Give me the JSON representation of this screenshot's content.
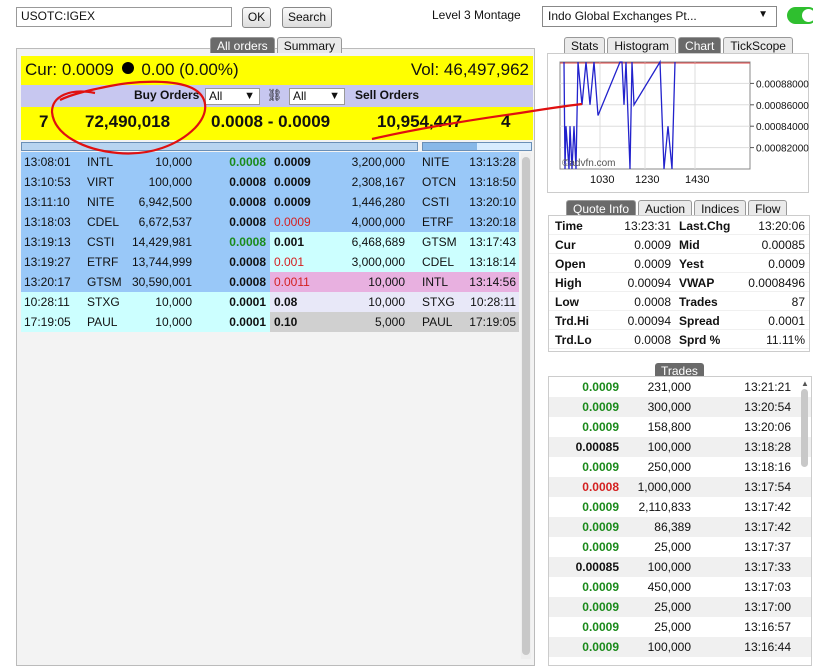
{
  "topbar": {
    "symbol": "USOTC:IGEX",
    "ok_label": "OK",
    "search_label": "Search",
    "montage_label": "Level 3 Montage",
    "exchange_selected": "Indo Global Exchanges Pt..."
  },
  "order_tabs": [
    "All orders",
    "Summary"
  ],
  "header": {
    "cur_label": "Cur:",
    "cur_price": "0.0009",
    "change": "0.00 (0.00%)",
    "vol_label": "Vol:",
    "volume": "46,497,962",
    "buy_orders_label": "Buy Orders",
    "sell_orders_label": "Sell Orders",
    "filter_buy": "All",
    "filter_sell": "All"
  },
  "summary": {
    "buy_count": "7",
    "buy_volume": "72,490,018",
    "spread_range": "0.0008 - 0.0009",
    "sell_volume": "10,954,447",
    "sell_count": "4"
  },
  "book": [
    {
      "bt": "13:08:01",
      "bmm": "INTL",
      "bsize": "10,000",
      "bprice": "0.0008",
      "bcolor": "green",
      "bbg": "#99c8f8",
      "sprice": "0.0009",
      "scolor": "black",
      "ssize": "3,200,000",
      "smm": "NITE",
      "st": "13:13:28",
      "sbg": "#99c8f8"
    },
    {
      "bt": "13:10:53",
      "bmm": "VIRT",
      "bsize": "100,000",
      "bprice": "0.0008",
      "bcolor": "black",
      "bbg": "#99c8f8",
      "sprice": "0.0009",
      "scolor": "black",
      "ssize": "2,308,167",
      "smm": "OTCN",
      "st": "13:18:50",
      "sbg": "#99c8f8"
    },
    {
      "bt": "13:11:10",
      "bmm": "NITE",
      "bsize": "6,942,500",
      "bprice": "0.0008",
      "bcolor": "black",
      "bbg": "#99c8f8",
      "sprice": "0.0009",
      "scolor": "black",
      "ssize": "1,446,280",
      "smm": "CSTI",
      "st": "13:20:10",
      "sbg": "#99c8f8"
    },
    {
      "bt": "13:18:03",
      "bmm": "CDEL",
      "bsize": "6,672,537",
      "bprice": "0.0008",
      "bcolor": "black",
      "bbg": "#99c8f8",
      "sprice": "0.0009",
      "scolor": "red",
      "ssize": "4,000,000",
      "smm": "ETRF",
      "st": "13:20:18",
      "sbg": "#99c8f8"
    },
    {
      "bt": "13:19:13",
      "bmm": "CSTI",
      "bsize": "14,429,981",
      "bprice": "0.0008",
      "bcolor": "green",
      "bbg": "#99c8f8",
      "sprice": "0.001",
      "scolor": "black",
      "ssize": "6,468,689",
      "smm": "GTSM",
      "st": "13:17:43",
      "sbg": "#ccffff"
    },
    {
      "bt": "13:19:27",
      "bmm": "ETRF",
      "bsize": "13,744,999",
      "bprice": "0.0008",
      "bcolor": "black",
      "bbg": "#99c8f8",
      "sprice": "0.001",
      "scolor": "red",
      "ssize": "3,000,000",
      "smm": "CDEL",
      "st": "13:18:14",
      "sbg": "#ccffff"
    },
    {
      "bt": "13:20:17",
      "bmm": "GTSM",
      "bsize": "30,590,001",
      "bprice": "0.0008",
      "bcolor": "black",
      "bbg": "#99c8f8",
      "sprice": "0.0011",
      "scolor": "red",
      "ssize": "10,000",
      "smm": "INTL",
      "st": "13:14:56",
      "sbg": "#e8b0e0"
    },
    {
      "bt": "10:28:11",
      "bmm": "STXG",
      "bsize": "10,000",
      "bprice": "0.0001",
      "bcolor": "black",
      "bbg": "#ccffff",
      "sprice": "0.08",
      "scolor": "black",
      "ssize": "10,000",
      "smm": "STXG",
      "st": "10:28:11",
      "sbg": "#e8e8f8"
    },
    {
      "bt": "17:19:05",
      "bmm": "PAUL",
      "bsize": "10,000",
      "bprice": "0.0001",
      "bcolor": "black",
      "bbg": "#ccffff",
      "sprice": "0.10",
      "scolor": "black",
      "ssize": "5,000",
      "smm": "PAUL",
      "st": "17:19:05",
      "sbg": "#d0d0d0"
    }
  ],
  "chart_tabs": [
    "Stats",
    "Histogram",
    "Chart",
    "TickScope"
  ],
  "chart_data": {
    "type": "line",
    "xlabel": "",
    "ylabel": "",
    "x_ticks": [
      "1030",
      "1230",
      "1430"
    ],
    "y_ticks": [
      "0.00088000",
      "0.00086000",
      "0.00084000",
      "0.00082000"
    ],
    "ylim": [
      0.0008,
      0.0009
    ],
    "watermark": "©advfn.com",
    "series": [
      {
        "color": "#2222cc",
        "values": [
          0.0009,
          0.0008,
          0.00084,
          0.0008,
          0.00084,
          0.0008,
          0.00084,
          0.0008,
          0.0009,
          0.00086,
          0.0009,
          0.00086,
          0.0009,
          0.00085,
          0.0009,
          0.0009,
          0.00086,
          0.0009,
          0.0008,
          0.0009,
          0.00086,
          0.0009,
          0.0008,
          0.00084,
          0.0008,
          0.0009
        ]
      }
    ]
  },
  "quote_tabs": [
    "Quote Info",
    "Auction",
    "Indices",
    "Flow"
  ],
  "quote": [
    {
      "l1": "Time",
      "v1": "13:23:31",
      "l2": "Last.Chg",
      "v2": "13:20:06"
    },
    {
      "l1": "Cur",
      "v1": "0.0009",
      "l2": "Mid",
      "v2": "0.00085"
    },
    {
      "l1": "Open",
      "v1": "0.0009",
      "l2": "Yest",
      "v2": "0.0009"
    },
    {
      "l1": "High",
      "v1": "0.00094",
      "l2": "VWAP",
      "v2": "0.0008496"
    },
    {
      "l1": "Low",
      "v1": "0.0008",
      "l2": "Trades",
      "v2": "87"
    },
    {
      "l1": "Trd.Hi",
      "v1": "0.00094",
      "l2": "Spread",
      "v2": "0.0001"
    },
    {
      "l1": "Trd.Lo",
      "v1": "0.0008",
      "l2": "Sprd %",
      "v2": "11.11%"
    }
  ],
  "trades_title": "Trades",
  "trades": [
    {
      "p": "0.0009",
      "c": "green",
      "s": "231,000",
      "t": "13:21:21"
    },
    {
      "p": "0.0009",
      "c": "green",
      "s": "300,000",
      "t": "13:20:54"
    },
    {
      "p": "0.0009",
      "c": "green",
      "s": "158,800",
      "t": "13:20:06"
    },
    {
      "p": "0.00085",
      "c": "black",
      "s": "100,000",
      "t": "13:18:28"
    },
    {
      "p": "0.0009",
      "c": "green",
      "s": "250,000",
      "t": "13:18:16"
    },
    {
      "p": "0.0008",
      "c": "red",
      "s": "1,000,000",
      "t": "13:17:54"
    },
    {
      "p": "0.0009",
      "c": "green",
      "s": "2,110,833",
      "t": "13:17:42"
    },
    {
      "p": "0.0009",
      "c": "green",
      "s": "86,389",
      "t": "13:17:42"
    },
    {
      "p": "0.0009",
      "c": "green",
      "s": "25,000",
      "t": "13:17:37"
    },
    {
      "p": "0.00085",
      "c": "black",
      "s": "100,000",
      "t": "13:17:33"
    },
    {
      "p": "0.0009",
      "c": "green",
      "s": "450,000",
      "t": "13:17:03"
    },
    {
      "p": "0.0009",
      "c": "green",
      "s": "25,000",
      "t": "13:17:00"
    },
    {
      "p": "0.0009",
      "c": "green",
      "s": "25,000",
      "t": "13:16:57"
    },
    {
      "p": "0.0009",
      "c": "green",
      "s": "100,000",
      "t": "13:16:44"
    }
  ]
}
